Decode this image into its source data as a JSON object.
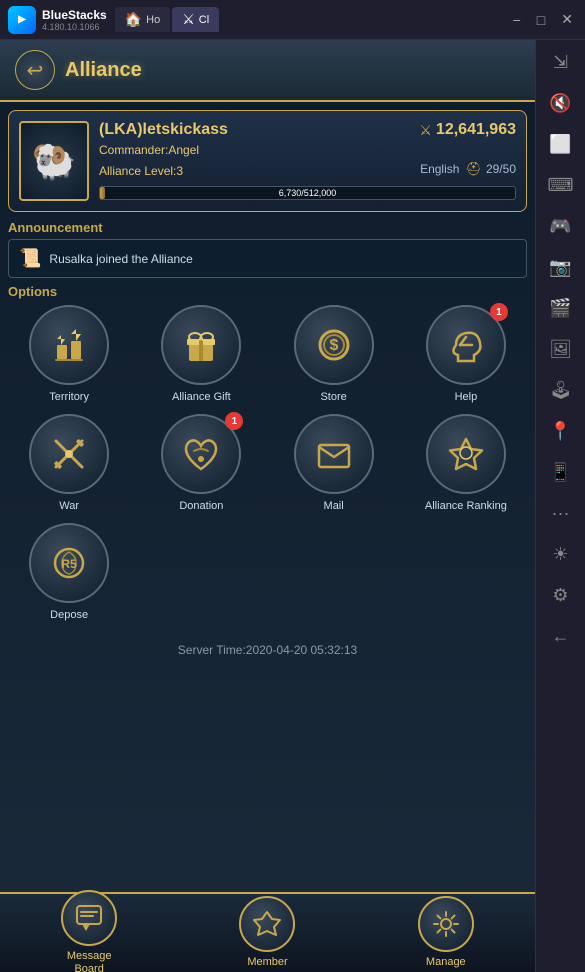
{
  "topbar": {
    "app_name": "BlueStacks",
    "version": "4.180.10.1066",
    "tabs": [
      {
        "label": "Ho",
        "active": false
      },
      {
        "label": "Cl",
        "active": true
      }
    ],
    "controls": [
      "−",
      "□",
      "✕"
    ]
  },
  "header": {
    "back_icon": "↩",
    "title": "Alliance"
  },
  "alliance": {
    "name": "(LKA)letskickass",
    "power_icon": "⚔",
    "power": "12,641,963",
    "commander_label": "Commander:",
    "commander": "Angel",
    "language": "English",
    "level_label": "Alliance Level:",
    "level": "3",
    "member_current": "29",
    "member_max": "50",
    "xp_current": "6,730",
    "xp_max": "512,000",
    "xp_display": "6,730/512,000",
    "xp_percent": 1.3
  },
  "announcement": {
    "label": "Announcement",
    "icon": "📜",
    "text": "Rusalka joined the Alliance"
  },
  "options": {
    "label": "Options",
    "items": [
      {
        "id": "territory",
        "label": "Territory",
        "icon": "🏰",
        "badge": null
      },
      {
        "id": "alliance-gift",
        "label": "Alliance Gift",
        "icon": "🎁",
        "badge": null
      },
      {
        "id": "store",
        "label": "Store",
        "icon": "💰",
        "badge": null
      },
      {
        "id": "help",
        "label": "Help",
        "icon": "🤝",
        "badge": "1"
      },
      {
        "id": "war",
        "label": "War",
        "icon": "⚔",
        "badge": null
      },
      {
        "id": "donation",
        "label": "Donation",
        "icon": "🌿",
        "badge": "1"
      },
      {
        "id": "mail",
        "label": "Mail",
        "icon": "✉",
        "badge": null
      },
      {
        "id": "alliance-ranking",
        "label": "Alliance Ranking",
        "icon": "🏆",
        "badge": null
      },
      {
        "id": "depose",
        "label": "Depose",
        "icon": "R5",
        "badge": null
      }
    ]
  },
  "server_time": {
    "label": "Server Time:",
    "value": "Server Time:2020-04-20 05:32:13"
  },
  "bottom_nav": [
    {
      "id": "message-board",
      "label": "Message\nBoard",
      "icon": "💬"
    },
    {
      "id": "member",
      "label": "Member",
      "icon": "⚔"
    },
    {
      "id": "manage",
      "label": "Manage",
      "icon": "⚙"
    }
  ],
  "right_sidebar_icons": [
    {
      "id": "expand",
      "symbol": "⇲"
    },
    {
      "id": "speaker",
      "symbol": "🔊"
    },
    {
      "id": "screen",
      "symbol": "📱"
    },
    {
      "id": "camera",
      "symbol": "📷"
    },
    {
      "id": "video",
      "symbol": "🎬"
    },
    {
      "id": "image",
      "symbol": "🖼"
    },
    {
      "id": "controller",
      "symbol": "🎮"
    },
    {
      "id": "location",
      "symbol": "📍"
    },
    {
      "id": "phone",
      "symbol": "📱"
    },
    {
      "id": "dots",
      "symbol": "···"
    },
    {
      "id": "brightness",
      "symbol": "☀"
    },
    {
      "id": "settings",
      "symbol": "⚙"
    },
    {
      "id": "back",
      "symbol": "←"
    }
  ]
}
